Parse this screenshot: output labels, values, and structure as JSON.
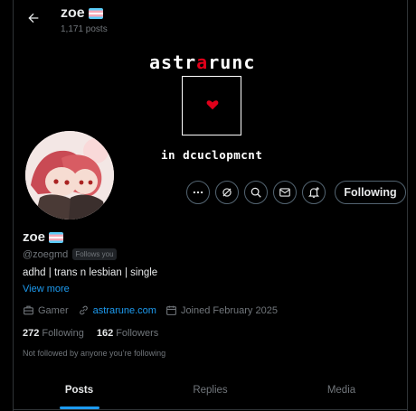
{
  "topbar": {
    "name": "zoe",
    "posts": "1,171 posts"
  },
  "banner": {
    "title_left": "astr",
    "title_heart": "a",
    "title_right": "runc",
    "subtitle": "in dcuclopmcnt"
  },
  "actions": {
    "more": "more-icon",
    "grok": "grok-icon",
    "search": "search-icon",
    "message": "mail-icon",
    "notify": "bell-plus-icon",
    "follow_label": "Following"
  },
  "profile": {
    "name": "zoe",
    "handle": "@zoegmd",
    "follows_you": "Follows you",
    "bio": "adhd | trans n lesbian | single",
    "view_more": "View more",
    "category": "Gamer",
    "website": "astrarune.com",
    "joined": "Joined February 2025",
    "following_count": "272",
    "following_label": "Following",
    "followers_count": "162",
    "followers_label": "Followers",
    "not_followed": "Not followed by anyone you’re following"
  },
  "tabs": [
    {
      "label": "Posts"
    },
    {
      "label": "Replies"
    },
    {
      "label": "Media"
    }
  ],
  "colors": {
    "accent": "#1d9bf0",
    "heart": "#e0001a",
    "muted": "#71767b"
  }
}
